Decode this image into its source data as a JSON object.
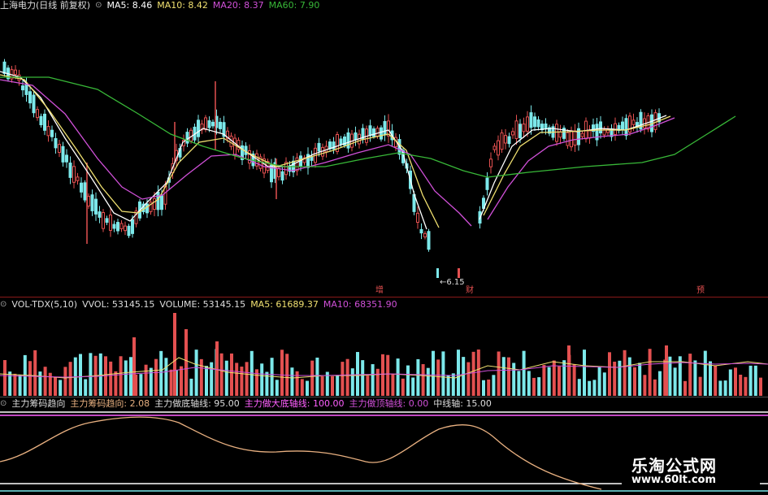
{
  "main_header": {
    "stock": "上海电力(日线 前复权)",
    "ma5": "MA5: 8.46",
    "ma10": "MA10: 8.42",
    "ma20": "MA20: 8.37",
    "ma60": "MA60: 7.90"
  },
  "vol_header": {
    "name": "VOL-TDX(5,10)",
    "vvol": "VVOL: 53145.15",
    "volume": "VOLUME: 53145.15",
    "ma5": "MA5: 61689.37",
    "ma10": "MA10: 68351.90"
  },
  "ind_header": {
    "name": "主力筹码趋向",
    "trend": "主力筹码趋向: 2.08",
    "bottom": "主力做底轴线: 95.00",
    "big_bottom": "主力做大底轴线: 100.00",
    "top": "主力做顶轴线: 0.00",
    "mid": "中线轴: 15.00"
  },
  "annotations": {
    "low_price": "←6.15",
    "flag_zeng": "增",
    "flag_cai": "财",
    "flag_yu": "预"
  },
  "watermark": {
    "title": "乐淘公式网",
    "url": "www.60lt.com"
  },
  "colors": {
    "up": "#e35050",
    "down": "#7ce8ea",
    "ma5": "#ffffff",
    "ma10": "#f0e070",
    "ma20": "#d050d8",
    "ma60": "#38b838",
    "trend": "#e8b080",
    "purple": "#ff60ff"
  }
}
